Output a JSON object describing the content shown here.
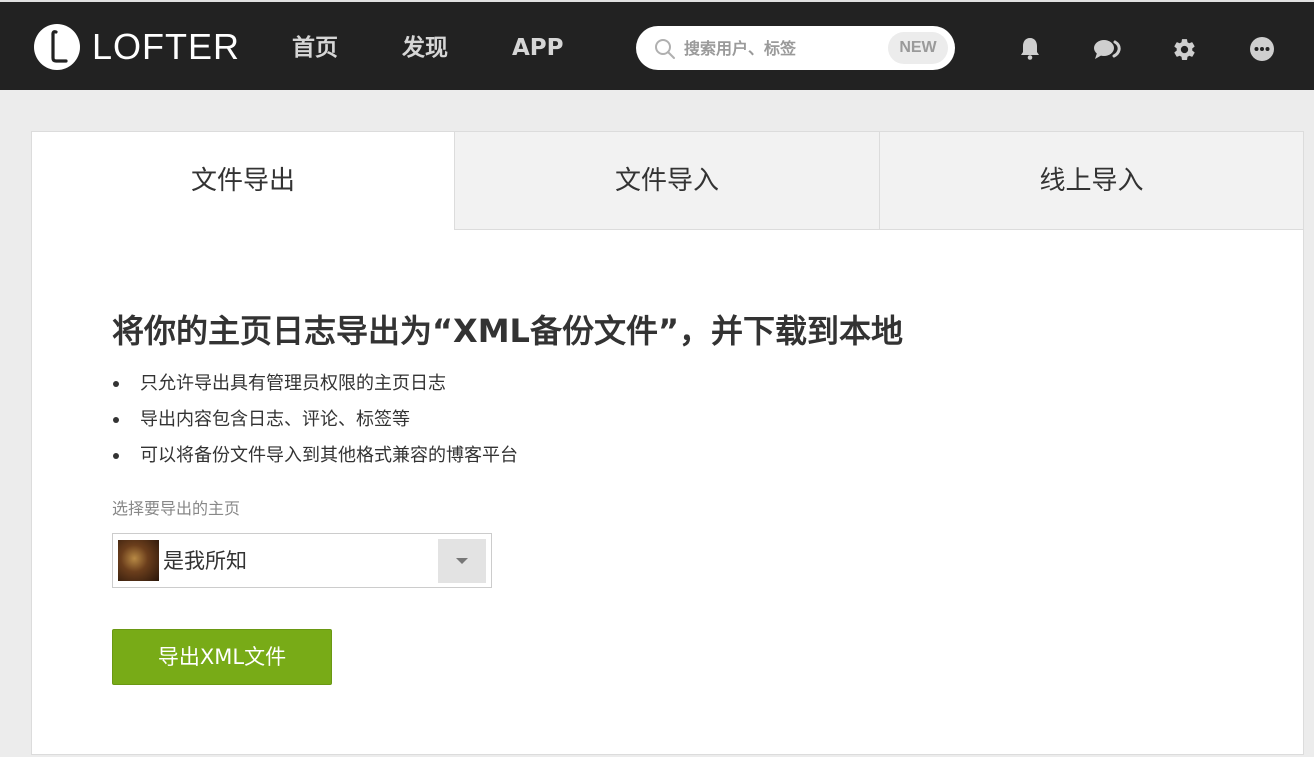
{
  "header": {
    "logo_text": "LOFTER",
    "nav": [
      {
        "label": "首页"
      },
      {
        "label": "发现"
      },
      {
        "label": "APP"
      }
    ],
    "search": {
      "placeholder": "搜索用户、标签",
      "value": "",
      "badge": "NEW"
    },
    "icons": [
      "bell-icon",
      "chat-icon",
      "gear-icon",
      "more-icon"
    ]
  },
  "tabs": [
    {
      "label": "文件导出",
      "active": true
    },
    {
      "label": "文件导入",
      "active": false
    },
    {
      "label": "线上导入",
      "active": false
    }
  ],
  "main": {
    "heading": "将你的主页日志导出为“XML备份文件”，并下载到本地",
    "bullets": [
      "只允许导出具有管理员权限的主页日志",
      "导出内容包含日志、评论、标签等",
      "可以将备份文件导入到其他格式兼容的博客平台"
    ],
    "select_label": "选择要导出的主页",
    "selected_blog": "是我所知",
    "export_button": "导出XML文件"
  },
  "colors": {
    "header_bg": "#222222",
    "accent_green": "#78ab17",
    "page_bg": "#ececec"
  }
}
